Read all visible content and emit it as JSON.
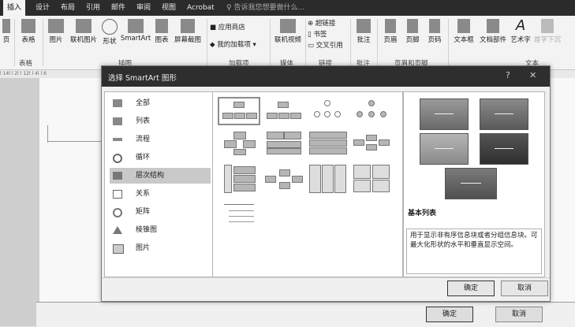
{
  "ribbon_tabs": [
    "插入",
    "设计",
    "布局",
    "引用",
    "邮件",
    "审阅",
    "视图",
    "Acrobat"
  ],
  "tell_me": "告诉我您想要做什么...",
  "ribbon_buttons": {
    "page": "页",
    "table": "表格",
    "picture": "图片",
    "online_picture": "联机图片",
    "shapes": "形状",
    "smartart": "SmartArt",
    "chart": "图表",
    "screenshot": "屏幕截图",
    "store": "应用商店",
    "my_addins": "我的加载项",
    "online_video": "联机视频",
    "hyperlink": "超链接",
    "bookmark": "书签",
    "cross_ref": "交叉引用",
    "comment": "批注",
    "header": "页眉",
    "footer": "页脚",
    "page_number": "页码",
    "textbox": "文本框",
    "doc_parts": "文档部件",
    "wordart": "艺术字",
    "dropcap": "首字下沉"
  },
  "ribbon_groups": {
    "tables": "表格",
    "illustrations": "插图",
    "addins": "加载项",
    "media": "媒体",
    "links": "链接",
    "comments": "批注",
    "header_footer": "页眉和页脚",
    "text": "文本"
  },
  "dialog": {
    "title": "选择 SmartArt 图形",
    "help": "?",
    "close": "✕",
    "categories": [
      {
        "label": "全部",
        "icon": "all-icon"
      },
      {
        "label": "列表",
        "icon": "list-icon"
      },
      {
        "label": "流程",
        "icon": "process-icon"
      },
      {
        "label": "循环",
        "icon": "cycle-icon"
      },
      {
        "label": "层次结构",
        "icon": "hierarchy-icon",
        "selected": true
      },
      {
        "label": "关系",
        "icon": "relationship-icon"
      },
      {
        "label": "矩阵",
        "icon": "matrix-icon"
      },
      {
        "label": "棱锥图",
        "icon": "pyramid-icon"
      },
      {
        "label": "图片",
        "icon": "picture-icon"
      }
    ],
    "preview_title": "基本列表",
    "preview_desc": "用于显示非有序信息块或者分组信息块。可最大化形状的水平和垂直显示空间。",
    "ok": "确定",
    "cancel": "取消"
  },
  "outer_buttons": {
    "ok": "确定",
    "cancel": "取消"
  },
  "ruler_text": "l 14l l 2l l 12l l 4l l 6"
}
